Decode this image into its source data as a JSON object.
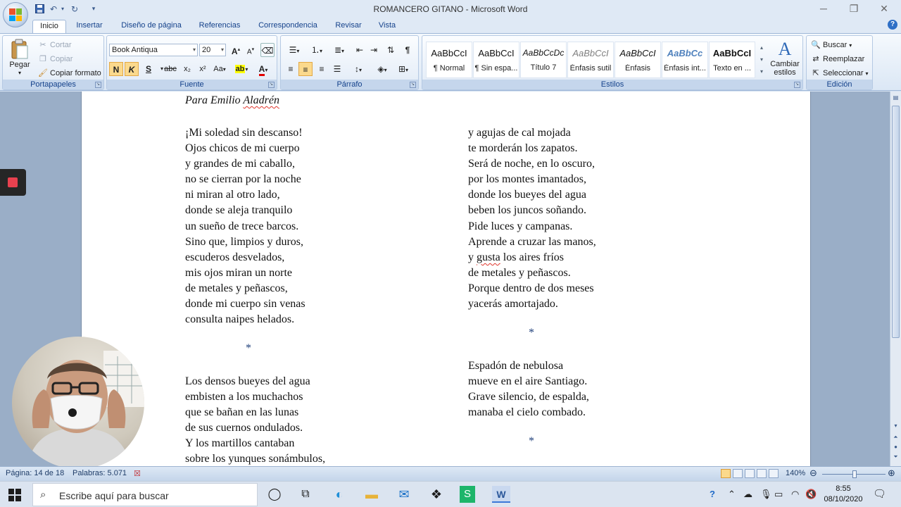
{
  "window": {
    "title": "ROMANCERO GITANO - Microsoft Word"
  },
  "tabs": [
    "Inicio",
    "Insertar",
    "Diseño de página",
    "Referencias",
    "Correspondencia",
    "Revisar",
    "Vista"
  ],
  "ribbon": {
    "clipboard": {
      "label": "Portapapeles",
      "paste": "Pegar",
      "cut": "Cortar",
      "copy": "Copiar",
      "format_painter": "Copiar formato"
    },
    "font": {
      "label": "Fuente",
      "font_name": "Book Antiqua",
      "font_size": "20",
      "bold": "N",
      "italic": "K",
      "underline": "S",
      "strikethrough": "abc",
      "subscript": "x₂",
      "superscript": "x²",
      "change_case": "Aa",
      "grow": "A",
      "shrink": "A"
    },
    "paragraph": {
      "label": "Párrafo"
    },
    "styles": {
      "label": "Estilos",
      "items": [
        {
          "sample": "AaBbCcI",
          "name": "¶ Normal"
        },
        {
          "sample": "AaBbCcI",
          "name": "¶ Sin espa..."
        },
        {
          "sample": "AaBbCcDc",
          "name": "Título 7"
        },
        {
          "sample": "AaBbCcI",
          "name": "Énfasis sutil"
        },
        {
          "sample": "AaBbCcI",
          "name": "Énfasis"
        },
        {
          "sample": "AaBbCc",
          "name": "Énfasis int..."
        },
        {
          "sample": "AaBbCcI",
          "name": "Texto en ..."
        }
      ],
      "change_styles": "Cambiar estilos"
    },
    "editing": {
      "label": "Edición",
      "find": "Buscar",
      "replace": "Reemplazar",
      "select": "Seleccionar"
    }
  },
  "document": {
    "dedication_prefix": "Para Emilio",
    "dedication_name": "Aladrén",
    "col1_stanza1": [
      "¡Mi soledad sin descanso!",
      "Ojos chicos de mi cuerpo",
      "y grandes de mi caballo,",
      "no se cierran por la noche",
      "ni miran al otro lado,",
      "donde se aleja tranquilo",
      "un sueño de trece barcos.",
      "Sino que, limpios y duros,",
      "escuderos desvelados,",
      "mis ojos miran un norte",
      "de metales y peñascos,",
      "donde mi cuerpo sin venas",
      "consulta naipes helados."
    ],
    "col1_stanza2": [
      "Los densos bueyes del agua",
      "embisten a los muchachos",
      "que se bañan en las lunas",
      "de sus cuernos ondulados.",
      "Y los martillos cantaban",
      "sobre los yunques sonámbulos,"
    ],
    "col2_stanza1": [
      "y agujas de cal mojada",
      "te morderán los zapatos.",
      "Será de noche, en lo oscuro,",
      "por los montes imantados,",
      "donde los bueyes del agua",
      "beben los juncos soñando.",
      "Pide luces y campanas.",
      "Aprende a cruzar las manos,",
      "y gusta los aires fríos",
      "de metales y peñascos.",
      "Porque dentro de dos meses",
      "yacerás amortajado."
    ],
    "col2_stanza2": [
      "Espadón de nebulosa",
      "mueve en el aire Santiago.",
      "Grave silencio, de espalda,",
      "manaba el cielo combado."
    ],
    "separator": "*"
  },
  "statusbar": {
    "page": "Página: 14 de 18",
    "words": "Palabras: 5.071",
    "zoom": "140%"
  },
  "taskbar": {
    "search_placeholder": "Escribe aquí para buscar",
    "time": "8:55",
    "date": "08/10/2020"
  },
  "colors": {
    "accent": "#15428b",
    "ribbon_bg": "#dbe7f5",
    "active_button": "#fbd98c"
  }
}
